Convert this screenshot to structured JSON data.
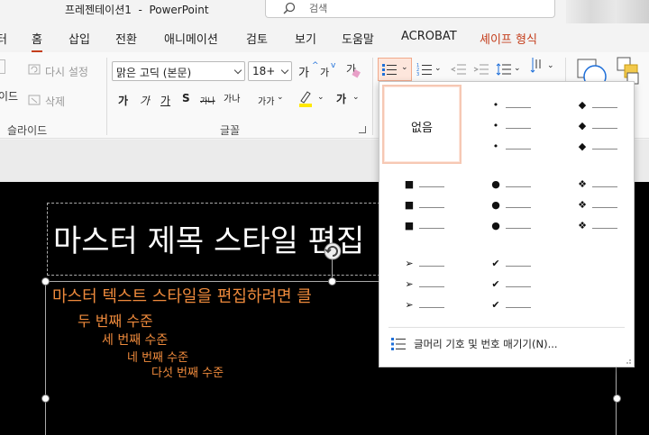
{
  "titlebar": {
    "doc_title": "프레젠테이션1  -  PowerPoint",
    "search_placeholder": "검색"
  },
  "tabs": [
    {
      "label": "터"
    },
    {
      "label": "홈"
    },
    {
      "label": "삽입"
    },
    {
      "label": "전환"
    },
    {
      "label": "애니메이션"
    },
    {
      "label": "검토"
    },
    {
      "label": "보기"
    },
    {
      "label": "도움말"
    },
    {
      "label": "ACROBAT"
    },
    {
      "label": "셰이프 형식"
    }
  ],
  "ribbon": {
    "slides": {
      "reset_label": "다시 설정",
      "delete_label": "삭제",
      "layout_partial": "이드",
      "group_label": "슬라이드"
    },
    "font": {
      "font_name": "맑은 고딕 (본문)",
      "font_size": "18+",
      "grow": "가",
      "shrink": "가",
      "bold": "가",
      "italic": "가",
      "underline": "가",
      "shadow": "S",
      "strike": "가나",
      "spacing": "가나",
      "case": "가가",
      "highlight": "가",
      "font_color": "가",
      "group_label": "글꼴"
    }
  },
  "slide": {
    "title": "마스터 제목 스타일 편집",
    "levels": [
      "마스터 텍스트 스타일을 편집하려면 클",
      "두 번째 수준",
      "세 번째 수준",
      "네 번째 수준",
      "다섯 번째 수준"
    ]
  },
  "bullet_menu": {
    "none_label": "없음",
    "styles": [
      {
        "id": "small-dot",
        "glyph": "•"
      },
      {
        "id": "diamond",
        "glyph": "◆"
      },
      {
        "id": "square",
        "glyph": "■"
      },
      {
        "id": "big-dot",
        "glyph": "●"
      },
      {
        "id": "four-diamond",
        "glyph": "❖"
      },
      {
        "id": "arrow",
        "glyph": "➢"
      },
      {
        "id": "check",
        "glyph": "✔"
      }
    ],
    "define_label": "글머리 기호 및 번호 매기기(N)..."
  },
  "colors": {
    "accent": "#c43e1c",
    "slide_text": "#ee8a3c"
  }
}
